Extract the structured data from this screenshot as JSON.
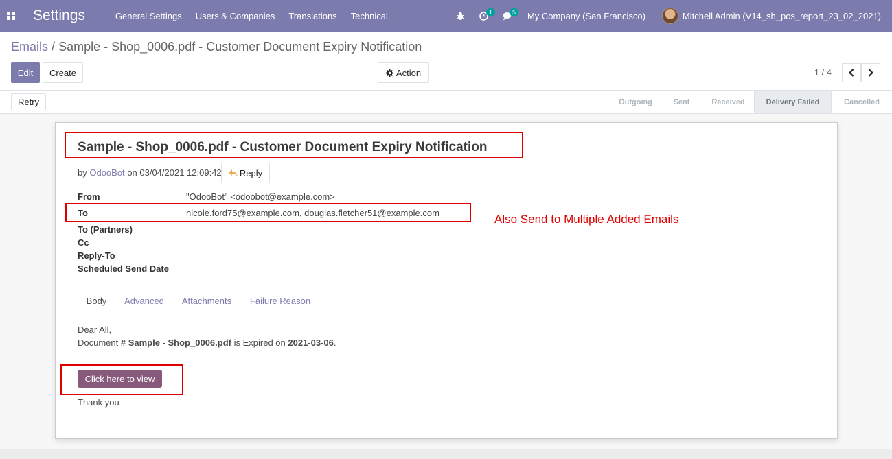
{
  "navbar": {
    "brand": "Settings",
    "menu": [
      "General Settings",
      "Users & Companies",
      "Translations",
      "Technical"
    ],
    "activity_badge": "1",
    "messages_badge": "5",
    "company": "My Company (San Francisco)",
    "user": "Mitchell Admin (V14_sh_pos_report_23_02_2021)"
  },
  "breadcrumb": {
    "parent": "Emails",
    "separator": "/",
    "current": "Sample - Shop_0006.pdf - Customer Document Expiry Notification"
  },
  "toolbar": {
    "edit_label": "Edit",
    "create_label": "Create",
    "action_label": "Action",
    "pager": "1 / 4"
  },
  "statusbar": {
    "retry_label": "Retry",
    "stages": [
      "Outgoing",
      "Sent",
      "Received",
      "Delivery Failed",
      "Cancelled"
    ],
    "active_stage": "Delivery Failed"
  },
  "mail": {
    "subject": "Sample - Shop_0006.pdf - Customer Document Expiry Notification",
    "by_prefix": "by",
    "author": "OdooBot",
    "date_text": "on 03/04/2021 12:09:42",
    "reply_label": "Reply",
    "fields": [
      {
        "label": "From",
        "value": "\"OdooBot\" <odoobot@example.com>"
      },
      {
        "label": "To",
        "value": "nicole.ford75@example.com, douglas.fletcher51@example.com"
      },
      {
        "label": "To (Partners)",
        "value": ""
      },
      {
        "label": "Cc",
        "value": ""
      },
      {
        "label": "Reply-To",
        "value": ""
      },
      {
        "label": "Scheduled Send Date",
        "value": ""
      }
    ],
    "tabs": [
      "Body",
      "Advanced",
      "Attachments",
      "Failure Reason"
    ],
    "active_tab": "Body",
    "body": {
      "greeting": "Dear All,",
      "line_prefix": "Document",
      "doc_name": "# Sample - Shop_0006.pdf",
      "line_middle": "is Expired on",
      "expiry_date": "2021-03-06",
      "line_suffix": ".",
      "view_button": "Click here to view",
      "closing": "Thank you"
    }
  },
  "annotation": {
    "text": "Also Send to Multiple Added Emails",
    "color": "#e00000"
  },
  "colors": {
    "brand": "#7c7bad",
    "odoo_button": "#875a7b"
  }
}
